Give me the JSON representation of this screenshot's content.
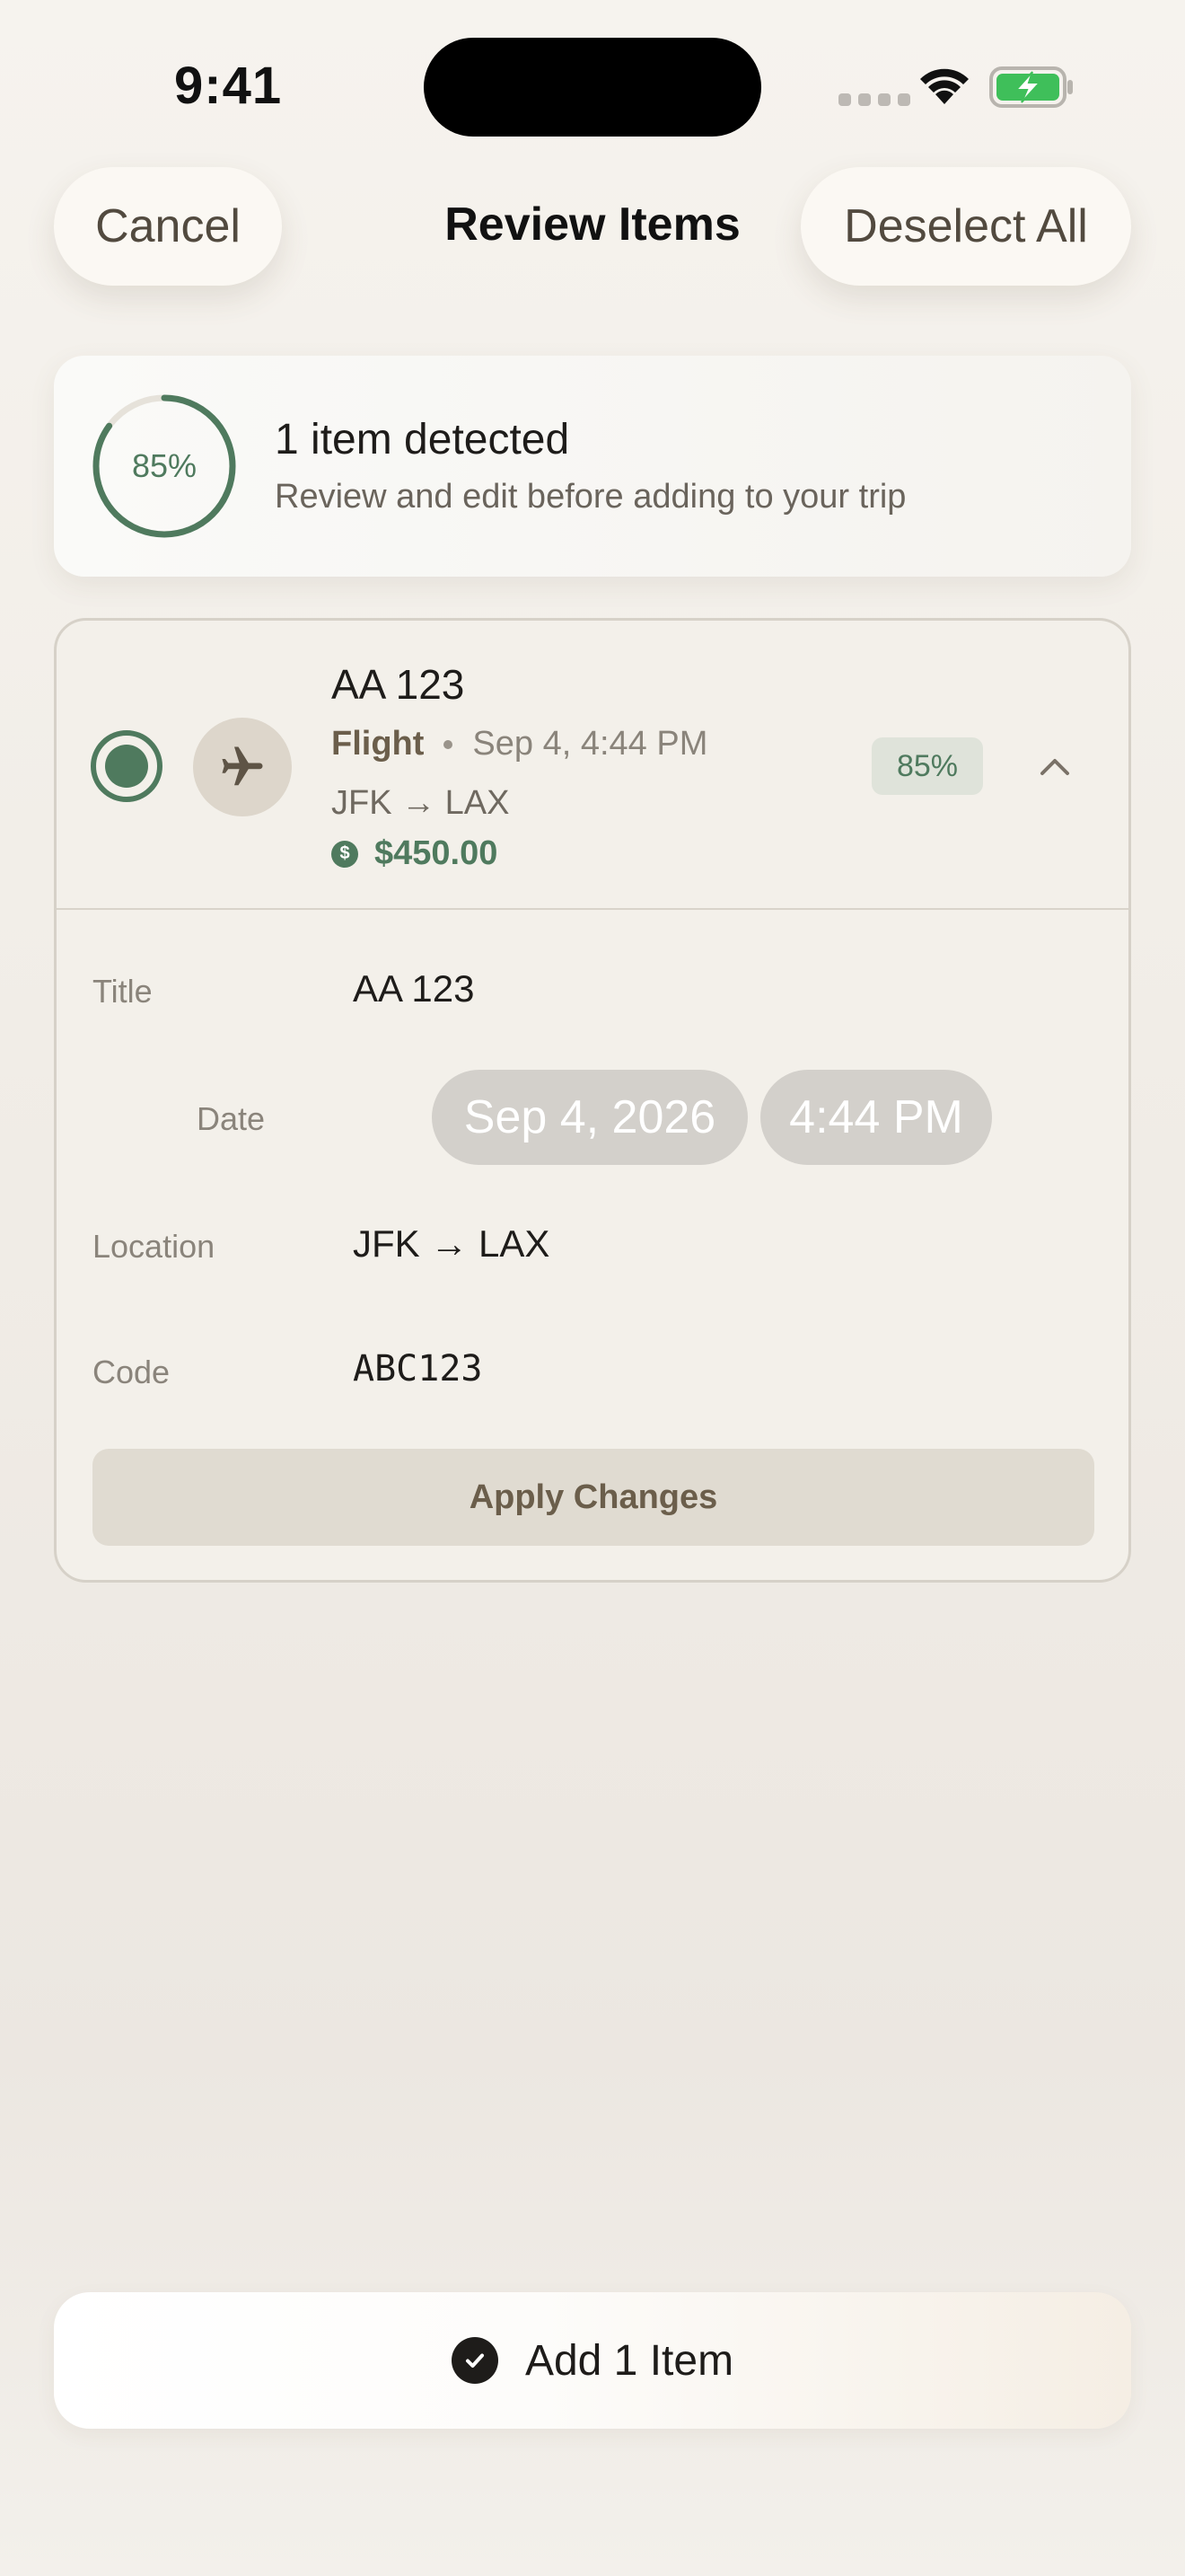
{
  "status_bar": {
    "time": "9:41"
  },
  "header": {
    "cancel_label": "Cancel",
    "title": "Review Items",
    "deselect_label": "Deselect All"
  },
  "summary": {
    "confidence": "85%",
    "confidence_fraction": 0.85,
    "title": "1 item detected",
    "subtitle": "Review and edit before adding to your trip"
  },
  "item": {
    "selected": true,
    "icon": "airplane-icon",
    "title": "AA 123",
    "type": "Flight",
    "datetime": "Sep 4, 4:44 PM",
    "route": "JFK → LAX",
    "price": "$450.00",
    "confidence": "85%",
    "expanded": true
  },
  "editor": {
    "title_label": "Title",
    "title_value": "AA 123",
    "date_label": "Date",
    "date_value": "Sep 4, 2026",
    "time_value": "4:44 PM",
    "location_label": "Location",
    "location_value": "JFK → LAX",
    "code_label": "Code",
    "code_value": "ABC123",
    "apply_label": "Apply Changes"
  },
  "footer": {
    "add_label": "Add 1 Item"
  },
  "colors": {
    "accent_green": "#4f7a5e",
    "brown_text": "#6b5e4b",
    "background": "#f3f0ea"
  }
}
